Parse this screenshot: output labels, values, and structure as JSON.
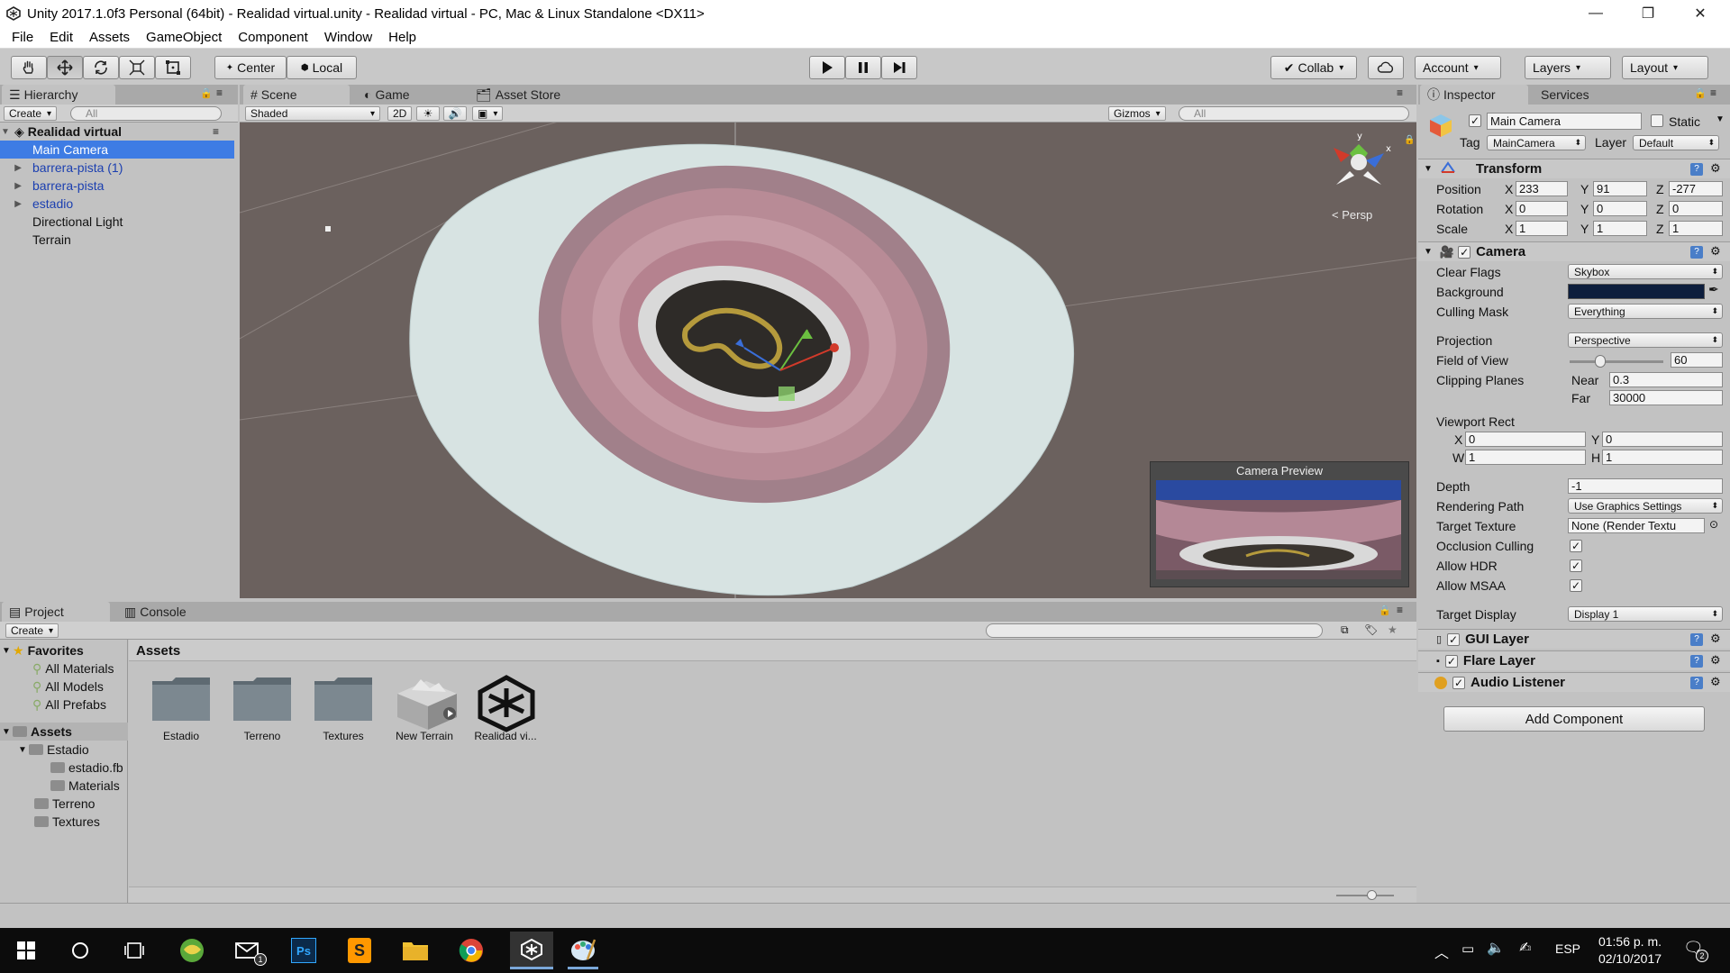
{
  "window": {
    "title": "Unity 2017.1.0f3 Personal (64bit) - Realidad virtual.unity - Realidad virtual - PC, Mac & Linux Standalone <DX11>",
    "minimize": "—",
    "maximize": "❐",
    "close": "✕"
  },
  "menu": [
    "File",
    "Edit",
    "Assets",
    "GameObject",
    "Component",
    "Window",
    "Help"
  ],
  "toolbar": {
    "center": "Center",
    "local": "Local",
    "collab": "Collab",
    "account": "Account",
    "layers": "Layers",
    "layout": "Layout"
  },
  "hierarchy": {
    "tab": "Hierarchy",
    "create": "Create",
    "search_placeholder": "All",
    "scene": "Realidad virtual",
    "items": [
      {
        "label": "Main Camera"
      },
      {
        "label": "barrera-pista (1)"
      },
      {
        "label": "barrera-pista"
      },
      {
        "label": "estadio"
      },
      {
        "label": "Directional Light"
      },
      {
        "label": "Terrain"
      }
    ]
  },
  "scene_view": {
    "tabs": [
      "Scene",
      "Game",
      "Asset Store"
    ],
    "shading": "Shaded",
    "mode_2d": "2D",
    "gizmos": "Gizmos",
    "search_placeholder": "All",
    "persp": "Persp",
    "camera_preview": "Camera Preview",
    "axis_y": "y",
    "axis_x": "x"
  },
  "inspector": {
    "tabs": [
      "Inspector",
      "Services"
    ],
    "object_name": "Main Camera",
    "static": "Static",
    "tag_label": "Tag",
    "tag": "MainCamera",
    "layer_label": "Layer",
    "layer": "Default",
    "transform": {
      "title": "Transform",
      "position": {
        "label": "Position",
        "x": "233",
        "y": "91",
        "z": "-277"
      },
      "rotation": {
        "label": "Rotation",
        "x": "0",
        "y": "0",
        "z": "0"
      },
      "scale": {
        "label": "Scale",
        "x": "1",
        "y": "1",
        "z": "1"
      }
    },
    "camera": {
      "title": "Camera",
      "clear_flags_label": "Clear Flags",
      "clear_flags": "Skybox",
      "background_label": "Background",
      "background_color": "#0d1e3d",
      "culling_mask_label": "Culling Mask",
      "culling_mask": "Everything",
      "projection_label": "Projection",
      "projection": "Perspective",
      "fov_label": "Field of View",
      "fov": "60",
      "fov_fraction": 0.33,
      "clipping_label": "Clipping Planes",
      "near_label": "Near",
      "near": "0.3",
      "far_label": "Far",
      "far": "30000",
      "viewport_label": "Viewport Rect",
      "vp_x": "0",
      "vp_y": "0",
      "vp_w": "1",
      "vp_h": "1",
      "depth_label": "Depth",
      "depth": "-1",
      "rendering_path_label": "Rendering Path",
      "rendering_path": "Use Graphics Settings",
      "target_texture_label": "Target Texture",
      "target_texture": "None (Render Textu",
      "occlusion_label": "Occlusion Culling",
      "hdr_label": "Allow HDR",
      "msaa_label": "Allow MSAA",
      "target_display_label": "Target Display",
      "target_display": "Display 1"
    },
    "components": [
      "GUI Layer",
      "Flare Layer",
      "Audio Listener"
    ],
    "add_component": "Add Component"
  },
  "project": {
    "tabs": [
      "Project",
      "Console"
    ],
    "create": "Create",
    "favorites": "Favorites",
    "favorite_items": [
      "All Materials",
      "All Models",
      "All Prefabs"
    ],
    "assets_root": "Assets",
    "tree": [
      {
        "label": "Estadio",
        "level": 1
      },
      {
        "label": "estadio.fb",
        "level": 2
      },
      {
        "label": "Materials",
        "level": 2
      },
      {
        "label": "Terreno",
        "level": 1
      },
      {
        "label": "Textures",
        "level": 1
      }
    ],
    "breadcrumb": "Assets",
    "assets": [
      {
        "label": "Estadio",
        "icon": "folder-icon"
      },
      {
        "label": "Terreno",
        "icon": "folder-icon"
      },
      {
        "label": "Textures",
        "icon": "folder-icon"
      },
      {
        "label": "New Terrain",
        "icon": "terrain-icon"
      },
      {
        "label": "Realidad vi...",
        "icon": "unity-scene-icon"
      }
    ]
  },
  "taskbar": {
    "lang": "ESP",
    "time": "01:56 p. m.",
    "date": "02/10/2017",
    "notif_count": "2",
    "mail_badge": "1"
  }
}
